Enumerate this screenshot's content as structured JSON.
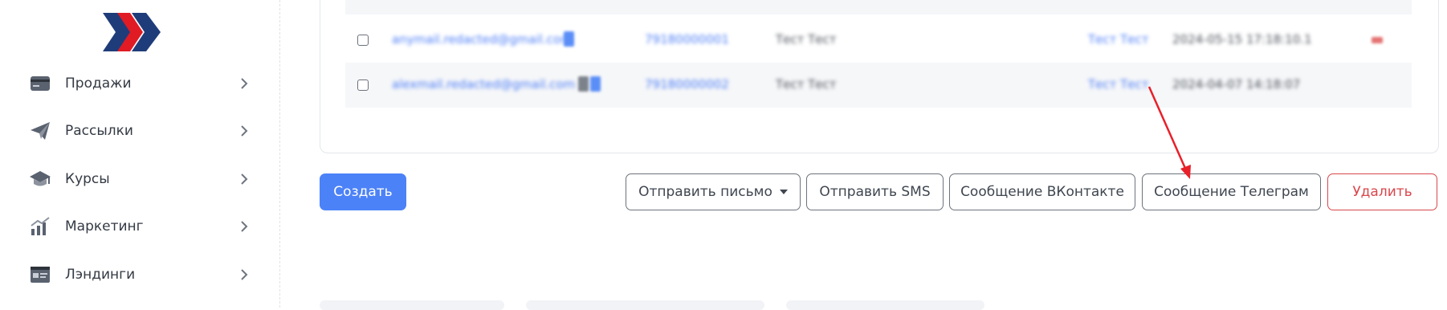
{
  "sidebar": {
    "items": [
      {
        "label": "Продажи",
        "icon": "card-icon"
      },
      {
        "label": "Рассылки",
        "icon": "paper-plane-icon"
      },
      {
        "label": "Курсы",
        "icon": "graduation-cap-icon"
      },
      {
        "label": "Маркетинг",
        "icon": "chart-growth-icon"
      },
      {
        "label": "Лэндинги",
        "icon": "landing-page-icon"
      }
    ]
  },
  "table": {
    "rows": [
      {
        "email": "anymail.redacted@gmail.com",
        "phone": "79180000001",
        "name": "Тест Тест",
        "source": "Тест Тест",
        "date": "2024-05-15 17:18:10.1"
      },
      {
        "email": "alexmail.redacted@gmail.com",
        "phone": "79180000002",
        "name": "Тест Тест",
        "source": "Тест Тест",
        "date": "2024-04-07 14:18:07"
      }
    ]
  },
  "actions": {
    "create_label": "Создать",
    "send_email_label": "Отправить письмо",
    "send_sms_label": "Отправить SMS",
    "vk_label": "Сообщение ВКонтакте",
    "telegram_label": "Сообщение Телеграм",
    "delete_label": "Удалить"
  },
  "colors": {
    "primary": "#4c82f7",
    "danger": "#d9474c",
    "link": "#4a7cf6",
    "annotation_arrow": "#e8202a",
    "logo_navy": "#1f3c7a",
    "logo_red": "#e01b24"
  }
}
